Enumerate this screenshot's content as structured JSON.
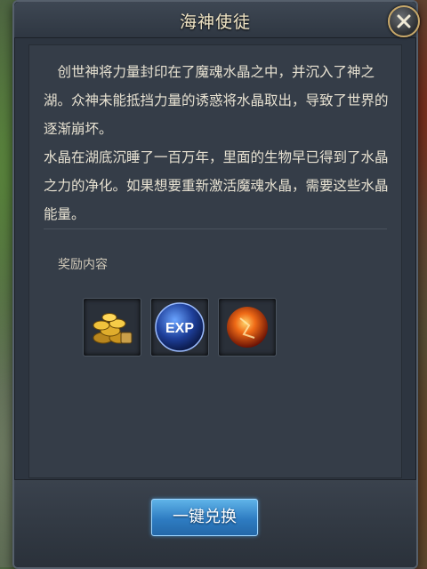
{
  "dialog": {
    "title": "海神使徒",
    "description": "　创世神将力量封印在了魔魂水晶之中，并沉入了神之湖。众神未能抵挡力量的诱惑将水晶取出，导致了世界的逐渐崩坏。\n水晶在湖底沉睡了一百万年，里面的生物早已得到了水晶之力的净化。如果想要重新激活魔魂水晶，需要这些水晶能量。",
    "reward_label": "奖励内容",
    "rewards": [
      {
        "icon": "gold-coins-icon"
      },
      {
        "icon": "exp-orb-icon",
        "label": "EXP"
      },
      {
        "icon": "fire-crystal-icon"
      }
    ],
    "exchange_button": "一键兑换"
  },
  "colors": {
    "title_text": "#f2e6c6",
    "panel_bg": "#2d3540",
    "button_blue": "#2e7cc2",
    "close_ring": "#c9a96a"
  }
}
